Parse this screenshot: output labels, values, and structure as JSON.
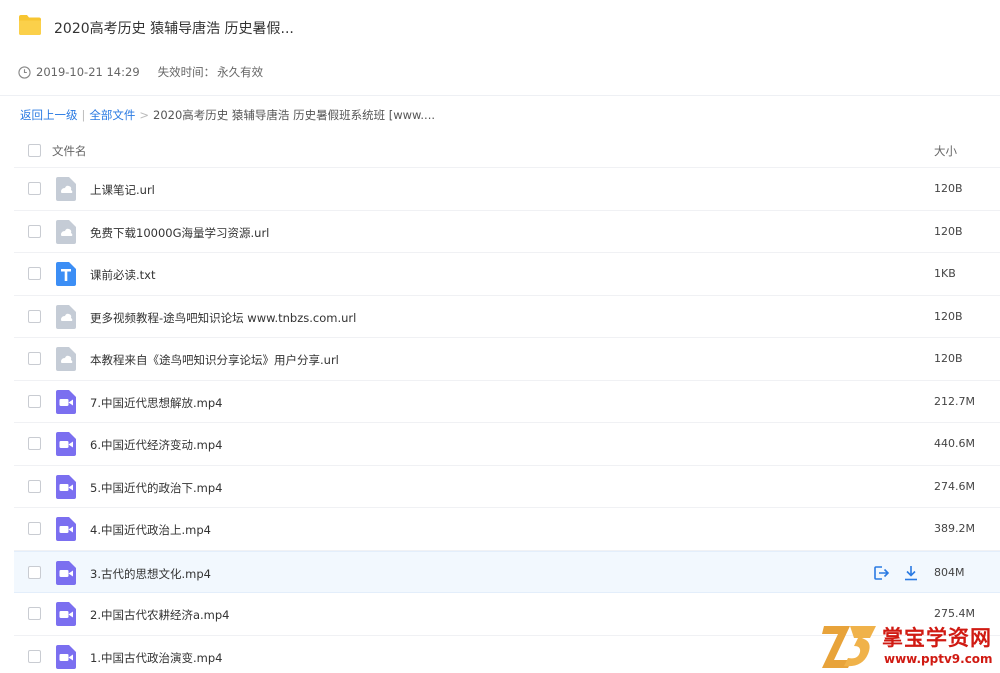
{
  "header": {
    "title": "2020高考历史 猿辅导唐浩 历史暑假...",
    "created": "2019-10-21 14:29",
    "expire_label": "失效时间：",
    "expire_value": "永久有效"
  },
  "breadcrumb": {
    "back": "返回上一级",
    "all_files": "全部文件",
    "current": "2020高考历史 猿辅导唐浩 历史暑假班系统班 [www...."
  },
  "table": {
    "col_name": "文件名",
    "col_size": "大小",
    "rows": [
      {
        "name": "上课笔记.url",
        "size": "120B",
        "icon": "link-file-icon"
      },
      {
        "name": "免费下载10000G海量学习资源.url",
        "size": "120B",
        "icon": "link-file-icon"
      },
      {
        "name": "课前必读.txt",
        "size": "1KB",
        "icon": "text-file-icon"
      },
      {
        "name": "更多视频教程-途鸟吧知识论坛 www.tnbzs.com.url",
        "size": "120B",
        "icon": "link-file-icon"
      },
      {
        "name": "本教程来自《途鸟吧知识分享论坛》用户分享.url",
        "size": "120B",
        "icon": "link-file-icon"
      },
      {
        "name": "7.中国近代思想解放.mp4",
        "size": "212.7M",
        "icon": "video-file-icon"
      },
      {
        "name": "6.中国近代经济变动.mp4",
        "size": "440.6M",
        "icon": "video-file-icon"
      },
      {
        "name": "5.中国近代的政治下.mp4",
        "size": "274.6M",
        "icon": "video-file-icon"
      },
      {
        "name": "4.中国近代政治上.mp4",
        "size": "389.2M",
        "icon": "video-file-icon"
      },
      {
        "name": "3.古代的思想文化.mp4",
        "size": "804M",
        "icon": "video-file-icon"
      },
      {
        "name": "2.中国古代农耕经济a.mp4",
        "size": "275.4M",
        "icon": "video-file-icon"
      },
      {
        "name": "1.中国古代政治演变.mp4",
        "size": "",
        "icon": "video-file-icon"
      }
    ]
  },
  "colors": {
    "link": "#2a7ae2",
    "folder": "#f7c531",
    "video": "#7b6ff0",
    "text_file": "#3c8ef5",
    "link_file": "#c5ccd6",
    "hover_row": "#f2f8fe",
    "watermark": "#d01a12"
  },
  "watermark": {
    "name": "掌宝学资网",
    "url": "www.pptv9.com"
  }
}
